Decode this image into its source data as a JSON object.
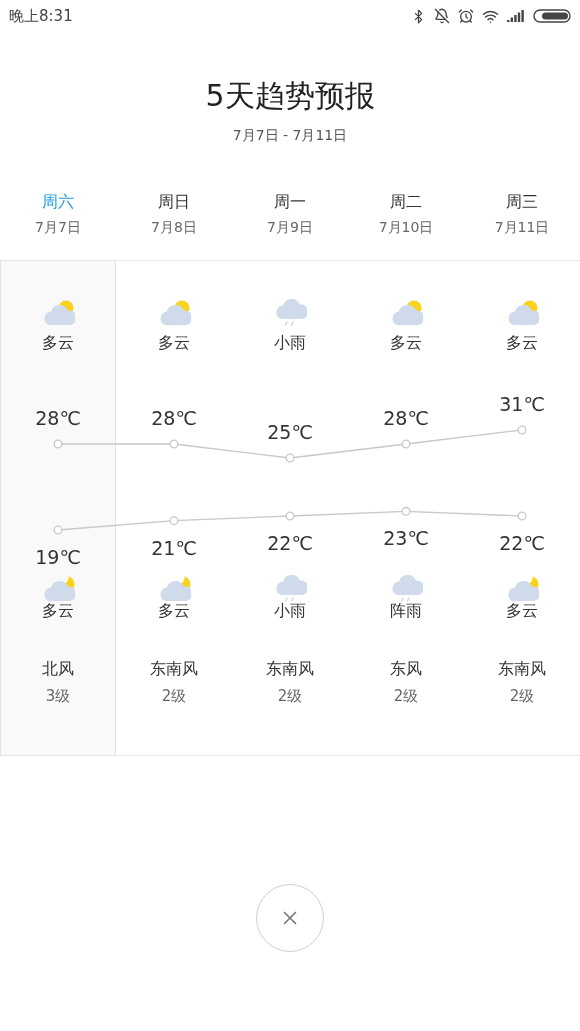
{
  "status_bar": {
    "time": "晚上8:31"
  },
  "title": "5天趋势预报",
  "date_range": "7月7日 - 7月11日",
  "days": [
    {
      "weekday": "周六",
      "date": "7月7日",
      "selected": true,
      "day": {
        "kind": "cloudy",
        "text": "多云"
      },
      "night": {
        "kind": "cloudy",
        "text": "多云"
      },
      "wind": "北风",
      "wind_level": "3级"
    },
    {
      "weekday": "周日",
      "date": "7月8日",
      "selected": false,
      "day": {
        "kind": "cloudy",
        "text": "多云"
      },
      "night": {
        "kind": "cloudy",
        "text": "多云"
      },
      "wind": "东南风",
      "wind_level": "2级"
    },
    {
      "weekday": "周一",
      "date": "7月9日",
      "selected": false,
      "day": {
        "kind": "rain",
        "text": "小雨"
      },
      "night": {
        "kind": "rain",
        "text": "小雨"
      },
      "wind": "东南风",
      "wind_level": "2级"
    },
    {
      "weekday": "周二",
      "date": "7月10日",
      "selected": false,
      "day": {
        "kind": "cloudy",
        "text": "多云"
      },
      "night": {
        "kind": "rain",
        "text": "阵雨"
      },
      "wind": "东风",
      "wind_level": "2级"
    },
    {
      "weekday": "周三",
      "date": "7月11日",
      "selected": false,
      "day": {
        "kind": "cloudy",
        "text": "多云"
      },
      "night": {
        "kind": "cloudy",
        "text": "多云"
      },
      "wind": "东南风",
      "wind_level": "2级"
    }
  ],
  "high_trend": {
    "chart_data": {
      "type": "line",
      "series": [
        {
          "color": "#c8c8c8",
          "marker": "circle",
          "values": [
            28,
            28,
            25,
            28,
            31
          ],
          "value_labels": [
            "28℃",
            "28℃",
            "25℃",
            "28℃",
            "31℃"
          ]
        }
      ]
    }
  },
  "low_trend": {
    "chart_data": {
      "type": "line",
      "series": [
        {
          "color": "#c8c8c8",
          "marker": "circle",
          "values": [
            19,
            21,
            22,
            23,
            22
          ],
          "value_labels": [
            "19℃",
            "21℃",
            "22℃",
            "23℃",
            "22℃"
          ]
        }
      ]
    }
  }
}
